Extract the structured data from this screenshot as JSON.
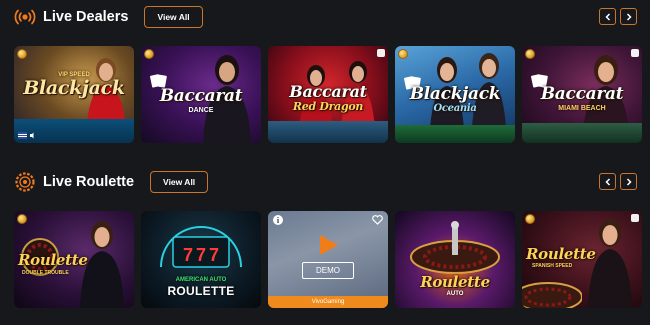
{
  "sections": {
    "live_dealers": {
      "title": "Live Dealers",
      "view_all": "View All",
      "icon": "broadcast-icon",
      "tiles": [
        {
          "title": "Blackjack",
          "top_text": "VIP SPEED"
        },
        {
          "title": "Baccarat",
          "subtitle": "DANCE"
        },
        {
          "title": "Baccarat",
          "subtitle": "Red Dragon"
        },
        {
          "title": "Blackjack",
          "subtitle": "Oceania"
        },
        {
          "title": "Baccarat",
          "subtitle": "MIAMI BEACH"
        }
      ]
    },
    "live_roulette": {
      "title": "Live Roulette",
      "view_all": "View All",
      "icon": "roulette-wheel-icon",
      "tiles": [
        {
          "title": "Roulette",
          "subtitle": "DOUBLE TROUBLE"
        },
        {
          "title": "ROULETTE",
          "top_text": "AMERICAN AUTO"
        },
        {
          "demo_label": "DEMO",
          "provider": "VivoGaming"
        },
        {
          "title": "Roulette",
          "subtitle": "AUTO"
        },
        {
          "title": "Roulette",
          "subtitle": "SPANISH SPEED"
        }
      ]
    }
  },
  "colors": {
    "accent": "#c9762b",
    "background": "#17181b"
  }
}
